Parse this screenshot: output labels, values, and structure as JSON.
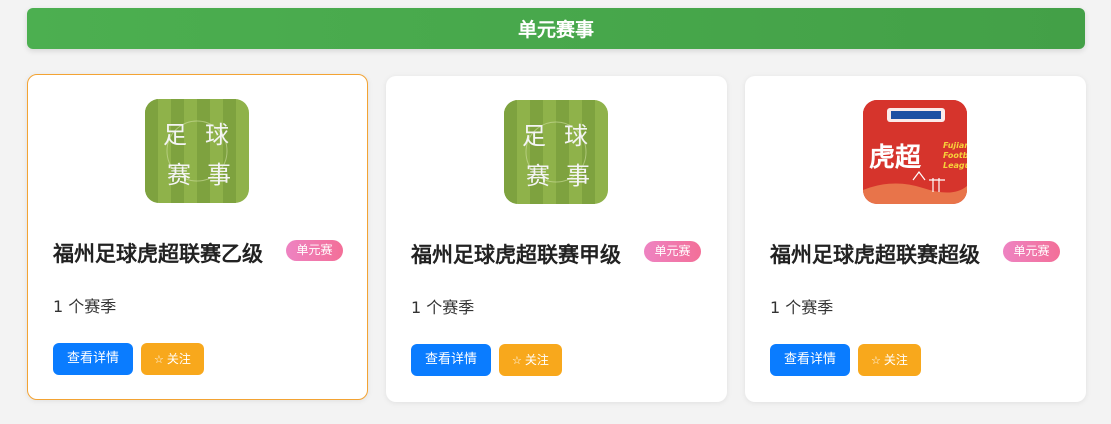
{
  "header": {
    "title": "单元赛事"
  },
  "cards": [
    {
      "title": "福州足球虎超联赛乙级",
      "badge": "单元赛",
      "seasons": "1 个赛季",
      "detail_label": "查看详情",
      "follow_label": "关注",
      "image_text": [
        "足",
        "球",
        "赛",
        "事"
      ]
    },
    {
      "title": "福州足球虎超联赛甲级",
      "badge": "单元赛",
      "seasons": "1 个赛季",
      "detail_label": "查看详情",
      "follow_label": "关注",
      "image_text": [
        "足",
        "球",
        "赛",
        "事"
      ]
    },
    {
      "title": "福州足球虎超联赛超级",
      "badge": "单元赛",
      "seasons": "1 个赛季",
      "detail_label": "查看详情",
      "follow_label": "关注",
      "image_text": [
        "虎超",
        "Fujian",
        "Footba",
        "League"
      ]
    }
  ],
  "colors": {
    "header_green": "#4caf50",
    "detail_blue": "#0a7cff",
    "follow_orange": "#f8a81c",
    "badge_pink": "#f36f98",
    "selected_border": "#f3a333"
  }
}
